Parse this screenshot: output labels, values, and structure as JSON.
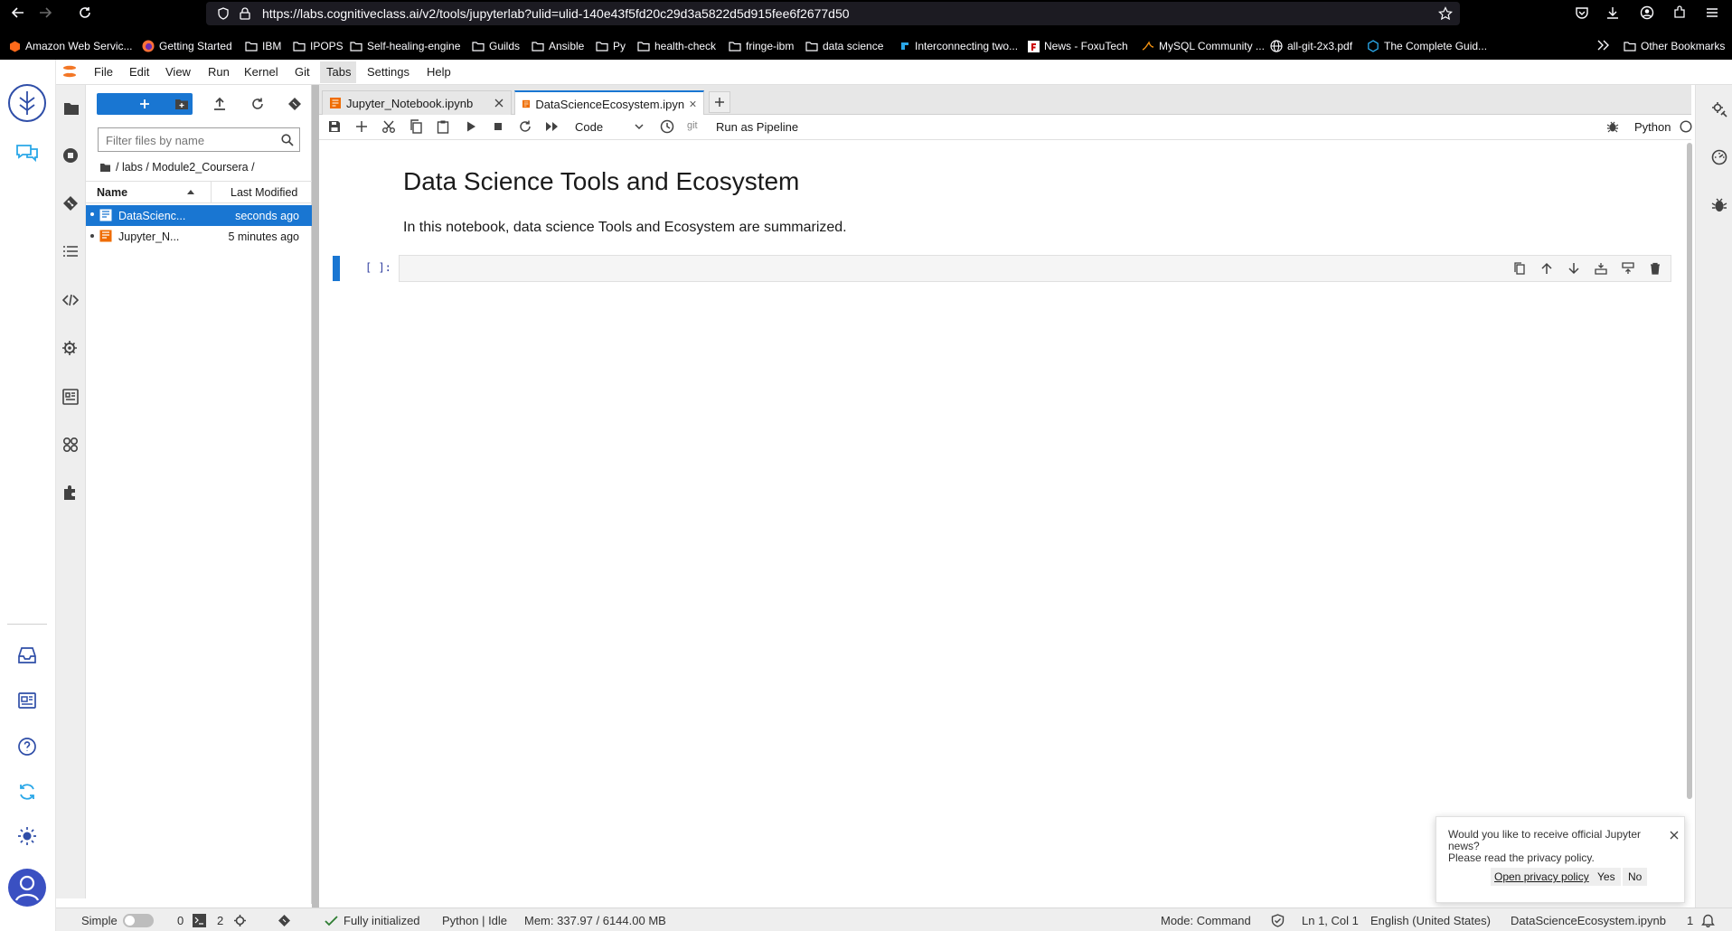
{
  "browser": {
    "url": "https://labs.cognitiveclass.ai/v2/tools/jupyterlab?ulid=ulid-140e43f5fd20c29d3a5822d5d915fee6f2677d50",
    "bookmarks": [
      "Amazon Web Servic...",
      "Getting Started",
      "IBM",
      "IPOPS",
      "Self-healing-engine",
      "Guilds",
      "Ansible",
      "Py",
      "health-check",
      "fringe-ibm",
      "data science",
      "Interconnecting two...",
      "News - FoxuTech",
      "MySQL Community ...",
      "all-git-2x3.pdf",
      "The Complete Guid...",
      "Other Bookmarks"
    ]
  },
  "menu": [
    "File",
    "Edit",
    "View",
    "Run",
    "Kernel",
    "Git",
    "Tabs",
    "Settings",
    "Help"
  ],
  "filebrowser": {
    "filter_placeholder": "Filter files by name",
    "breadcrumb": "/ labs / Module2_Coursera /",
    "col_name": "Name",
    "col_modified": "Last Modified",
    "files": [
      {
        "name": "DataScienc...",
        "modified": "seconds ago"
      },
      {
        "name": "Jupyter_N...",
        "modified": "5 minutes ago"
      }
    ]
  },
  "tabs": [
    {
      "label": "Jupyter_Notebook.ipynb"
    },
    {
      "label": "DataScienceEcosystem.ipyn"
    }
  ],
  "toolbar": {
    "cell_type": "Code",
    "git_label": "git",
    "pipeline_label": "Run as Pipeline",
    "kernel_name": "Python"
  },
  "notebook": {
    "title": "Data Science Tools and Ecosystem",
    "intro": "In this notebook, data science Tools and Ecosystem are summarized.",
    "prompt": "[ ]:"
  },
  "notification": {
    "line1": "Would you like to receive official Jupyter",
    "line2": "news?",
    "line3": "Please read the privacy policy.",
    "policy_button": "Open privacy policy",
    "yes": "Yes",
    "no": "No"
  },
  "statusbar": {
    "simple": "Simple",
    "terminals": "0",
    "kernels": "2",
    "init": "Fully initialized",
    "kernel_status": "Python | Idle",
    "memory": "Mem: 337.97 / 6144.00 MB",
    "mode": "Mode: Command",
    "cursor": "Ln 1, Col 1",
    "language": "English (United States)",
    "filename": "DataScienceEcosystem.ipynb",
    "notif_count": "1"
  }
}
